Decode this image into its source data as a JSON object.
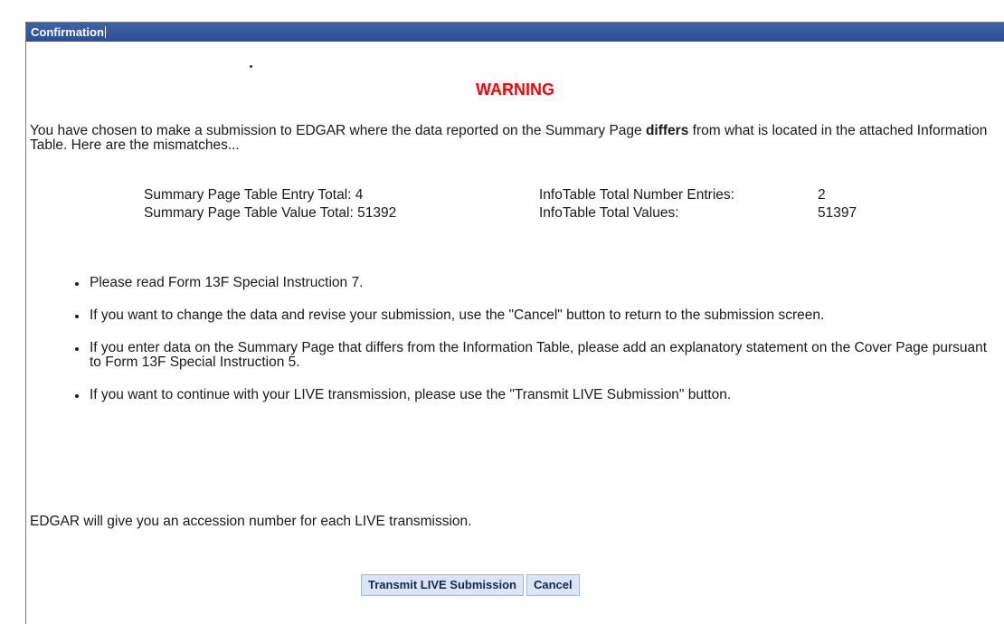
{
  "dialog": {
    "title": "Confirmation"
  },
  "warning": {
    "heading": "WARNING",
    "intro_before": "You have chosen to make a submission to EDGAR where the data reported on the Summary Page ",
    "intro_bold": "differs",
    "intro_after": " from what is located in the attached Information Table. Here are the mismatches..."
  },
  "mismatches": [
    {
      "summary_label": "Summary Page Table Entry Total:",
      "summary_value": "4",
      "infotable_label": "InfoTable Total Number Entries:",
      "infotable_value": "2"
    },
    {
      "summary_label": "Summary Page Table Value Total:",
      "summary_value": "51392",
      "infotable_label": "InfoTable Total Values:",
      "infotable_value": "51397"
    }
  ],
  "instructions": [
    "Please read Form 13F Special Instruction 7.",
    "If you want to change the data and revise your submission, use the \"Cancel\" button to return to the submission screen.",
    "If you enter data on the Summary Page that differs from the Information Table, please add an explanatory statement on the Cover Page pursuant to Form 13F Special Instruction 5.",
    "If you want to continue with your LIVE transmission, please use the \"Transmit LIVE Submission\" button."
  ],
  "closing": "EDGAR will give you an accession number for each LIVE transmission.",
  "buttons": {
    "transmit_label": "Transmit LIVE Submission",
    "cancel_label": "Cancel"
  }
}
